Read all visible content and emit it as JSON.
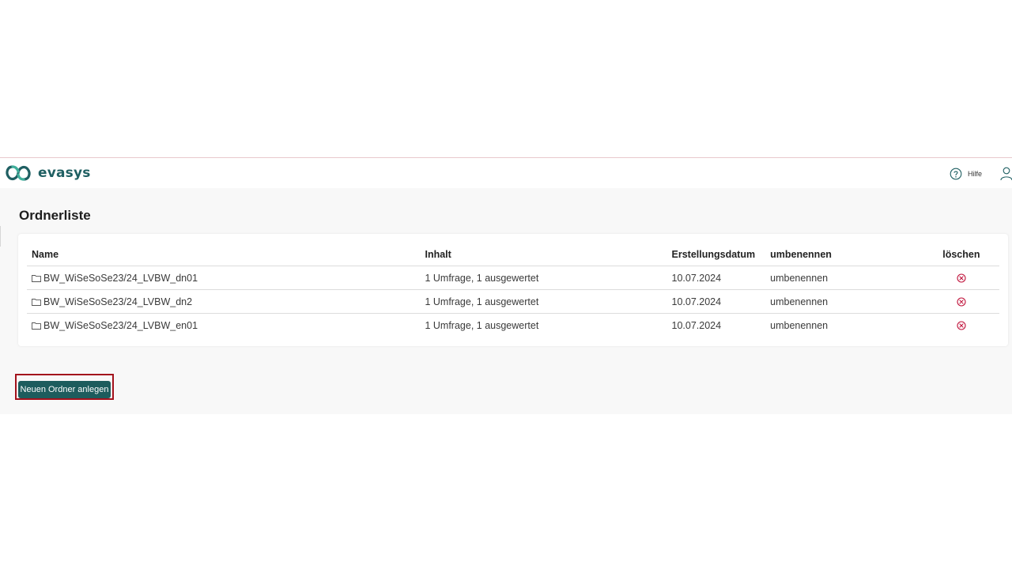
{
  "brand": {
    "name": "evasys",
    "primary_color": "#1f5f62",
    "accent_color": "#3fae9a"
  },
  "header": {
    "help_label": "Hilfe",
    "help_icon": "help-circle-icon",
    "user_icon": "user-icon"
  },
  "page": {
    "title": "Ordnerliste"
  },
  "table": {
    "columns": [
      "Name",
      "Inhalt",
      "Erstellungsdatum",
      "umbenennen",
      "löschen"
    ],
    "rows": [
      {
        "name": "BW_WiSeSoSe23/24_LVBW_dn01",
        "content": "1 Umfrage, 1 ausgewertet",
        "date": "10.07.2024",
        "rename": "umbenennen",
        "delete_icon": "delete-circle-x-icon"
      },
      {
        "name": "BW_WiSeSoSe23/24_LVBW_dn2",
        "content": "1 Umfrage, 1 ausgewertet",
        "date": "10.07.2024",
        "rename": "umbenennen",
        "delete_icon": "delete-circle-x-icon"
      },
      {
        "name": "BW_WiSeSoSe23/24_LVBW_en01",
        "content": "1 Umfrage, 1 ausgewertet",
        "date": "10.07.2024",
        "rename": "umbenennen",
        "delete_icon": "delete-circle-x-icon"
      }
    ],
    "delete_color": "#c0143c"
  },
  "actions": {
    "new_folder_label": "Neuen Ordner anlegen",
    "button_color": "#1d5c5d",
    "highlight_color": "#a3121c"
  }
}
